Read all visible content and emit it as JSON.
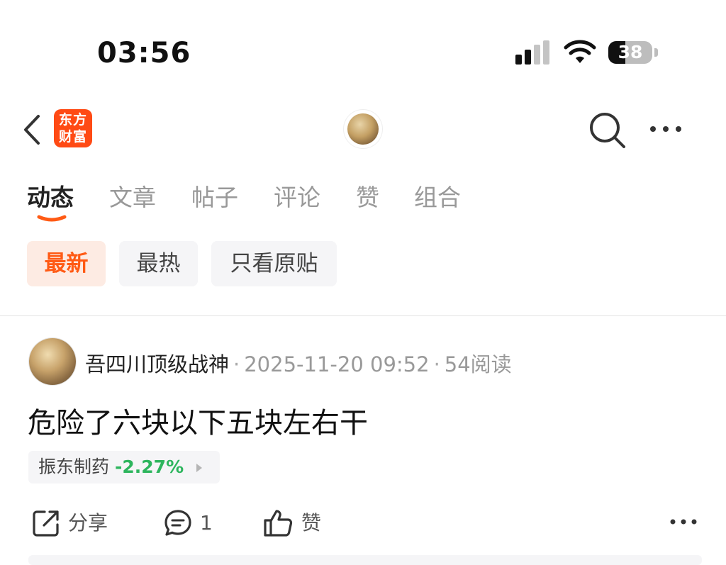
{
  "status_bar": {
    "time": "03:56",
    "battery": "38",
    "battery_level": 0.38,
    "signal_icon": "cellular-signal-icon",
    "wifi_icon": "wifi-icon"
  },
  "nav": {
    "back_icon": "chevron-left-icon",
    "logo_line1": "东方",
    "logo_line2": "财富",
    "search_icon": "search-icon",
    "more_icon": "more-horizontal-icon"
  },
  "tabs": [
    {
      "label": "动态",
      "active": true
    },
    {
      "label": "文章"
    },
    {
      "label": "帖子"
    },
    {
      "label": "评论"
    },
    {
      "label": "赞"
    },
    {
      "label": "组合"
    }
  ],
  "filters": [
    {
      "label": "最新",
      "active": true
    },
    {
      "label": "最热"
    },
    {
      "label": "只看原贴"
    }
  ],
  "post": {
    "author": "吾四川顶级战神",
    "datetime": "2025-11-20 09:52",
    "reads": "54阅读",
    "content": "危险了六块以下五块左右干",
    "stock": {
      "name": "振东制药",
      "change": "-2.27%"
    },
    "actions": {
      "share": "分享",
      "comments": "1",
      "like": "赞"
    }
  },
  "colors": {
    "accent": "#ff5a14",
    "logo_bg": "#ff4a14",
    "down": "#2db55d",
    "chip_bg": "#f5f5f7",
    "active_chip_bg": "#fdebe3"
  }
}
